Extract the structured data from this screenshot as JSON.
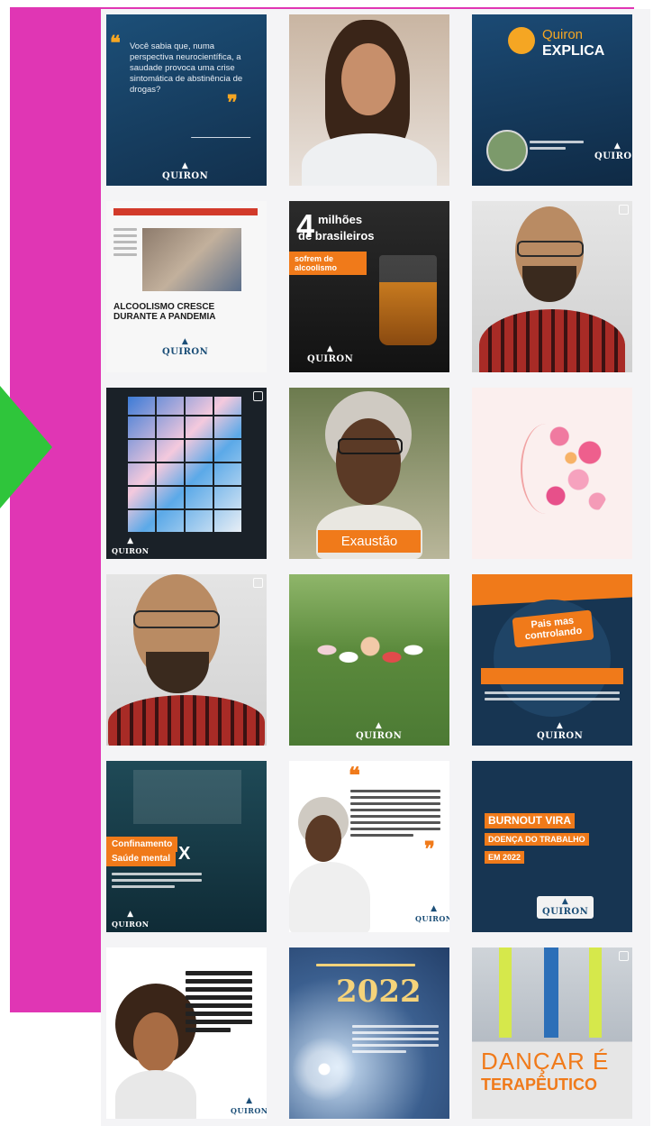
{
  "tiles": {
    "t1": {
      "quote": "Você sabia que, numa perspectiva neurocientífica, a saudade provoca uma crise sintomática de abstinência de drogas?",
      "open_quote": "❝",
      "close_quote": "❞",
      "logo": "QUIRON"
    },
    "t3": {
      "brand": "Quiron",
      "title": "EXPLICA",
      "logo": "QUIRON"
    },
    "t4": {
      "headline": "ALCOOLISMO CRESCE DURANTE A PANDEMIA",
      "logo": "QUIRON"
    },
    "t5": {
      "big": "4",
      "line1": "milhões",
      "line2": "de brasileiros",
      "tag": "sofrem de alcoolismo",
      "logo": "QUIRON"
    },
    "t8": {
      "caption": "Exaustão"
    },
    "t11": {
      "logo": "QUIRON"
    },
    "t12": {
      "badge": "Pais mas controlando",
      "logo": "QUIRON"
    },
    "t13": {
      "caption_a": "Confinamento",
      "caption_b": "Saúde mental",
      "x": "X",
      "logo": "QUIRON"
    },
    "t14": {
      "quote_mark": "❝",
      "close_mark": "❞",
      "logo": "QUIRON"
    },
    "t15": {
      "line1": "BURNOUT VIRA",
      "line2": "DOENÇA DO TRABALHO",
      "line3": "EM 2022",
      "logo": "QUIRON"
    },
    "t16": {
      "logo": "QUIRON"
    },
    "t17": {
      "year": "2022"
    },
    "t18": {
      "line1": "DANÇAR É",
      "line2": "TERAPÊUTICO"
    }
  },
  "colors": {
    "magenta": "#e036b4",
    "green": "#2fc53b",
    "navy": "#173552",
    "orange": "#f07a1a"
  }
}
